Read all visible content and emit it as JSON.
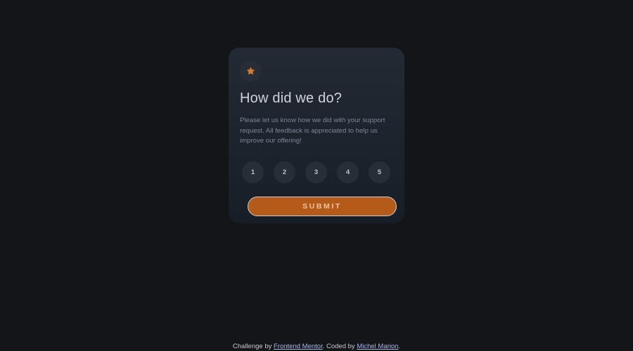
{
  "card": {
    "icon": "star-icon",
    "title": "How did we do?",
    "description": "Please let us know how we did with your support request. All feedback is appreciated to help us improve our offering!",
    "ratings": [
      "1",
      "2",
      "3",
      "4",
      "5"
    ],
    "submit_label": "SUBMIT"
  },
  "footer": {
    "challenge_prefix": "Challenge by ",
    "challenge_link": "Frontend Mentor",
    "coded_prefix": ". Coded by ",
    "coded_link": "Michel Marion",
    "suffix": "."
  },
  "colors": {
    "background": "#131518",
    "accent": "#b55b1a",
    "star": "#d97b2a"
  }
}
